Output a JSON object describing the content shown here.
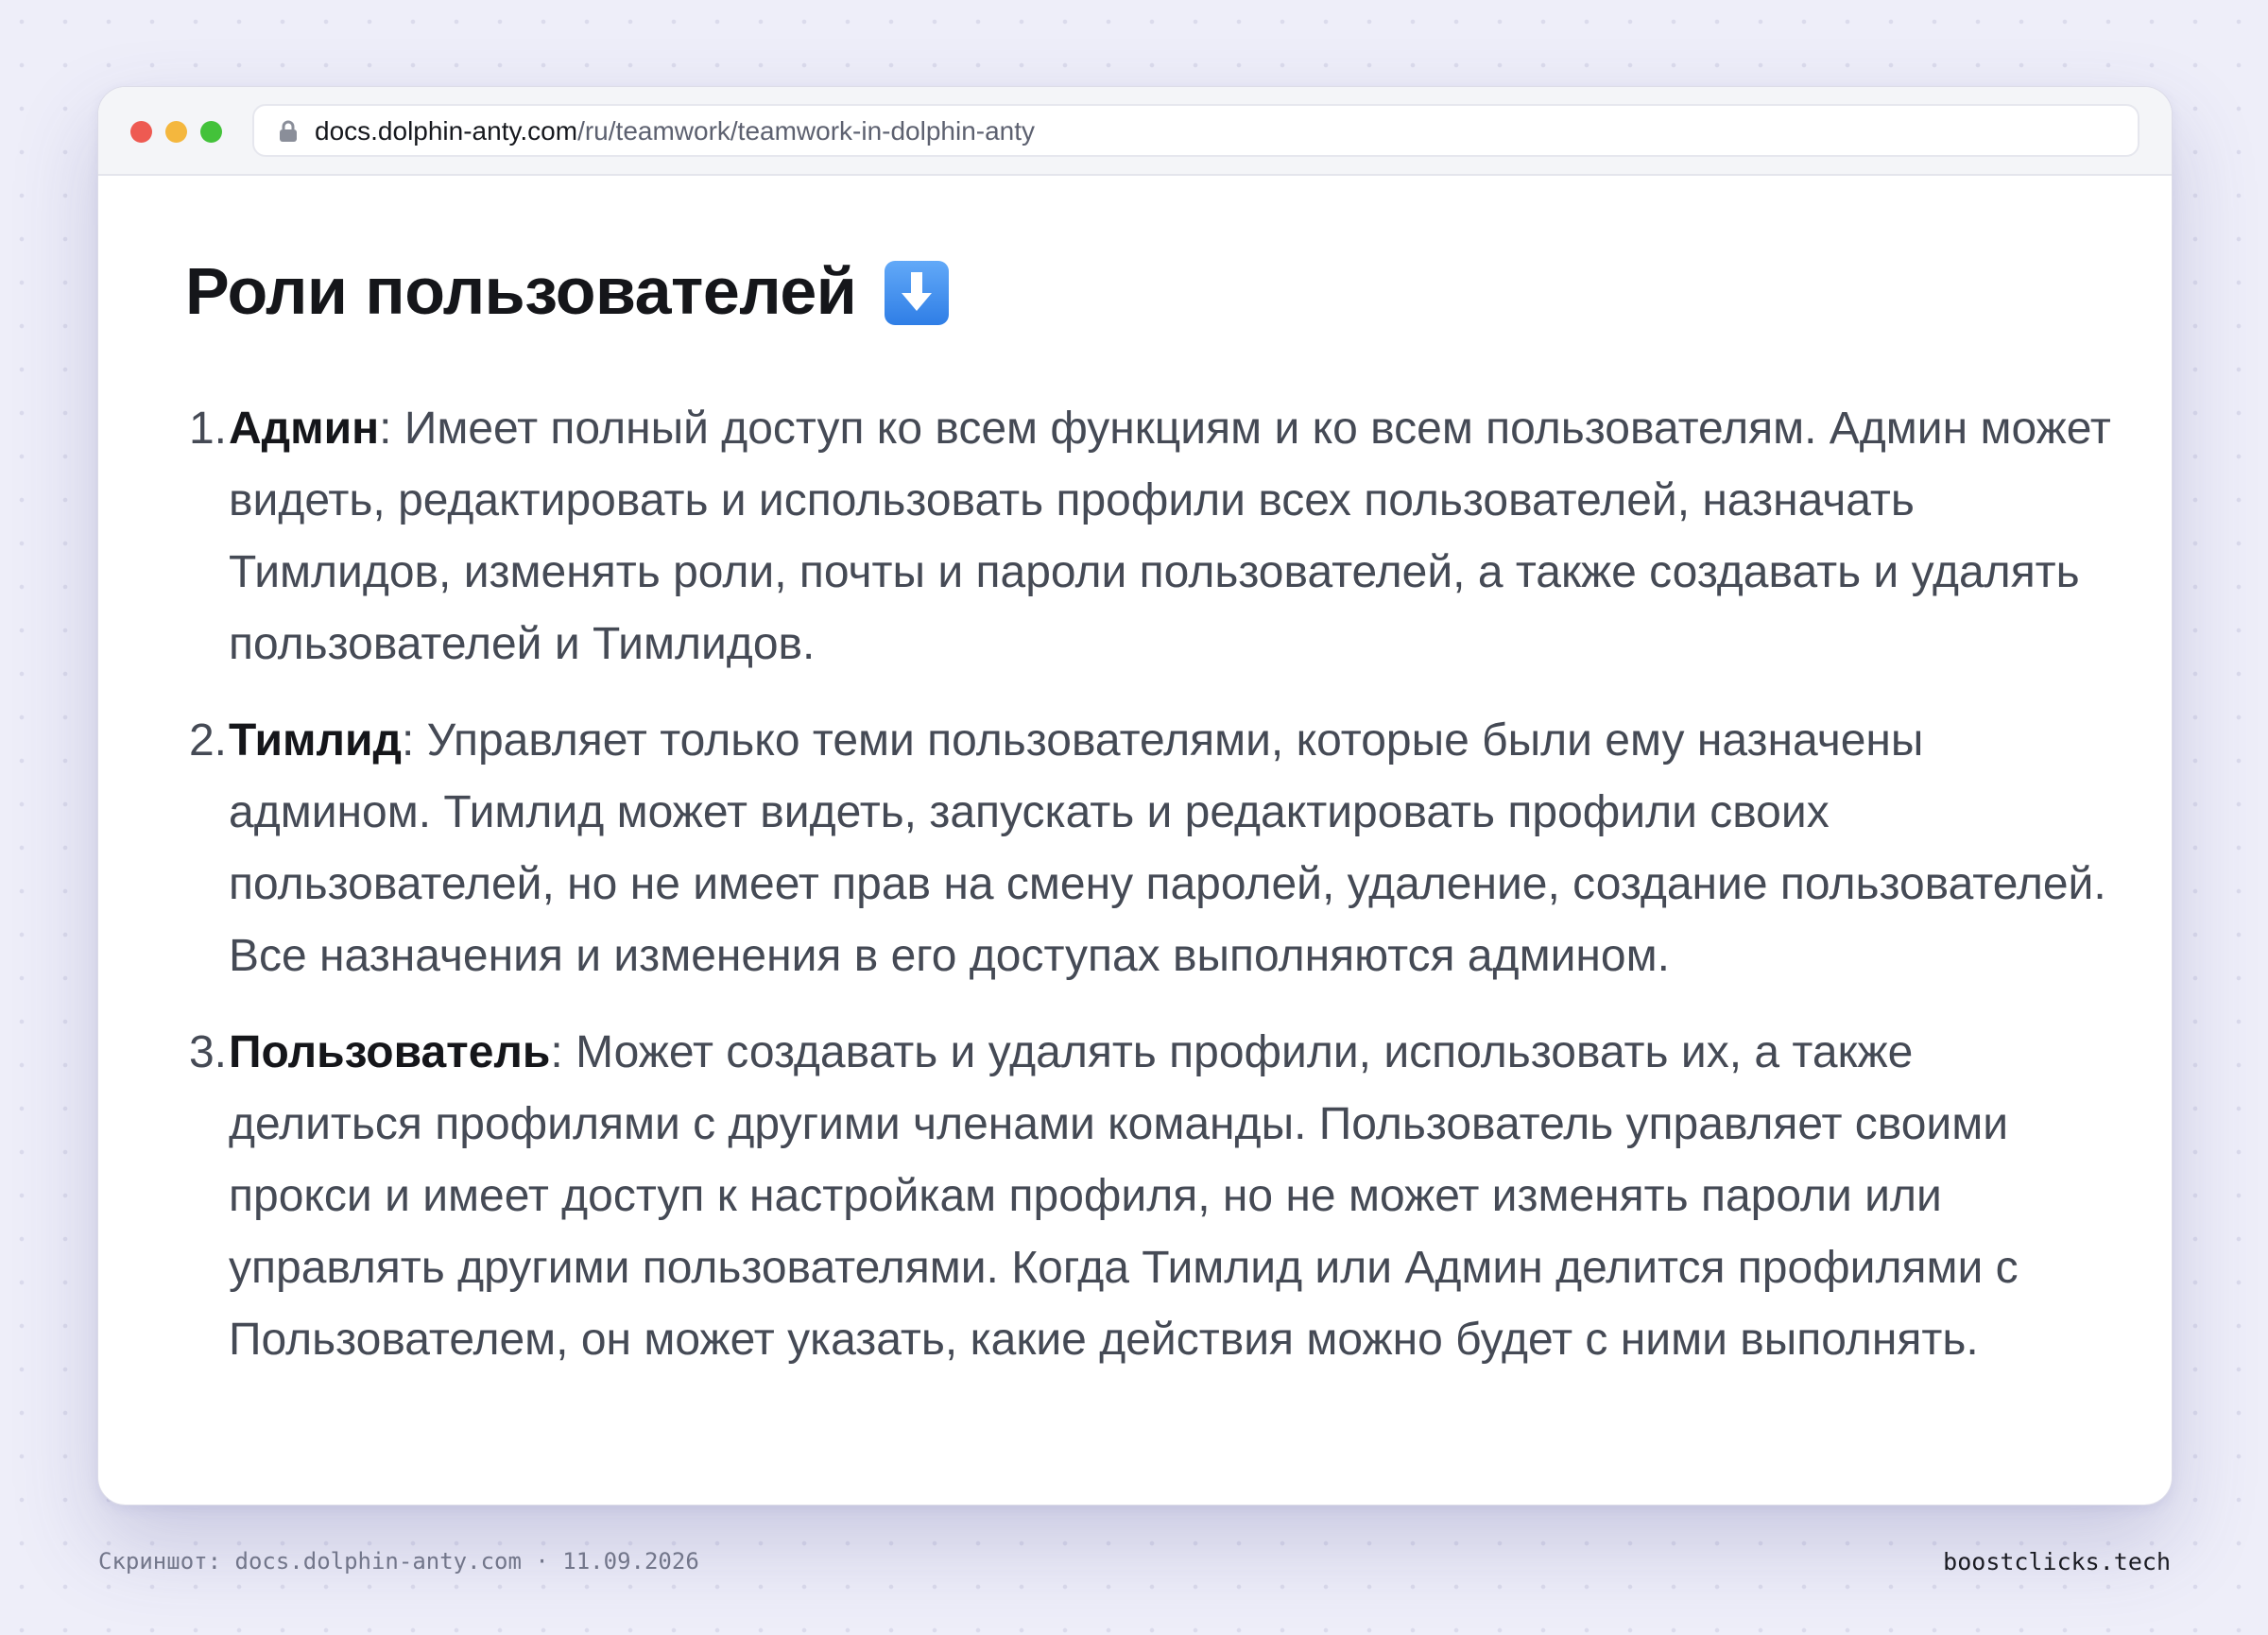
{
  "browser": {
    "url_domain": "docs.dolphin-anty.com",
    "url_path": "/ru/teamwork/teamwork-in-dolphin-anty"
  },
  "page": {
    "heading": "Роли пользователей",
    "heading_icon": "down-arrow-emoji",
    "roles": [
      {
        "number": "1.",
        "name": "Админ",
        "description": ": Имеет полный доступ ко всем функциям и ко всем пользователям. Админ может видеть, редактировать и использовать профили всех пользователей, назначать Тимлидов, изменять роли, почты и пароли пользователей, а также создавать и удалять пользователей и Тимлидов."
      },
      {
        "number": "2.",
        "name": "Тимлид",
        "description": ": Управляет только теми пользователями, которые были ему назначены админом. Тимлид может видеть, запускать и редактировать профили своих пользователей, но не имеет прав на смену паролей, удаление, создание пользователей. Все назначения и изменения в его доступах выполняются админом."
      },
      {
        "number": "3.",
        "name": "Пользователь",
        "description": ": Может создавать и удалять профили, использовать их, а также делиться профилями с другими членами команды. Пользователь управляет своими прокси и имеет доступ к настройкам профиля, но не может изменять пароли или управлять другими пользователями. Когда Тимлид или Админ делится профилями с Пользователем, он может указать, какие действия можно будет с ними выполнять."
      }
    ]
  },
  "footer": {
    "caption": "Скриншот: docs.dolphin-anty.com · 11.09.2026",
    "brand": "boostclicks.tech"
  },
  "colors": {
    "background": "#eeeef9",
    "heading_text": "#15161a",
    "body_text": "#454a55",
    "dot_red": "#ee5a52",
    "dot_yellow": "#f4b73e",
    "dot_green": "#43c23a",
    "arrow_icon": "#3d8ef0"
  }
}
